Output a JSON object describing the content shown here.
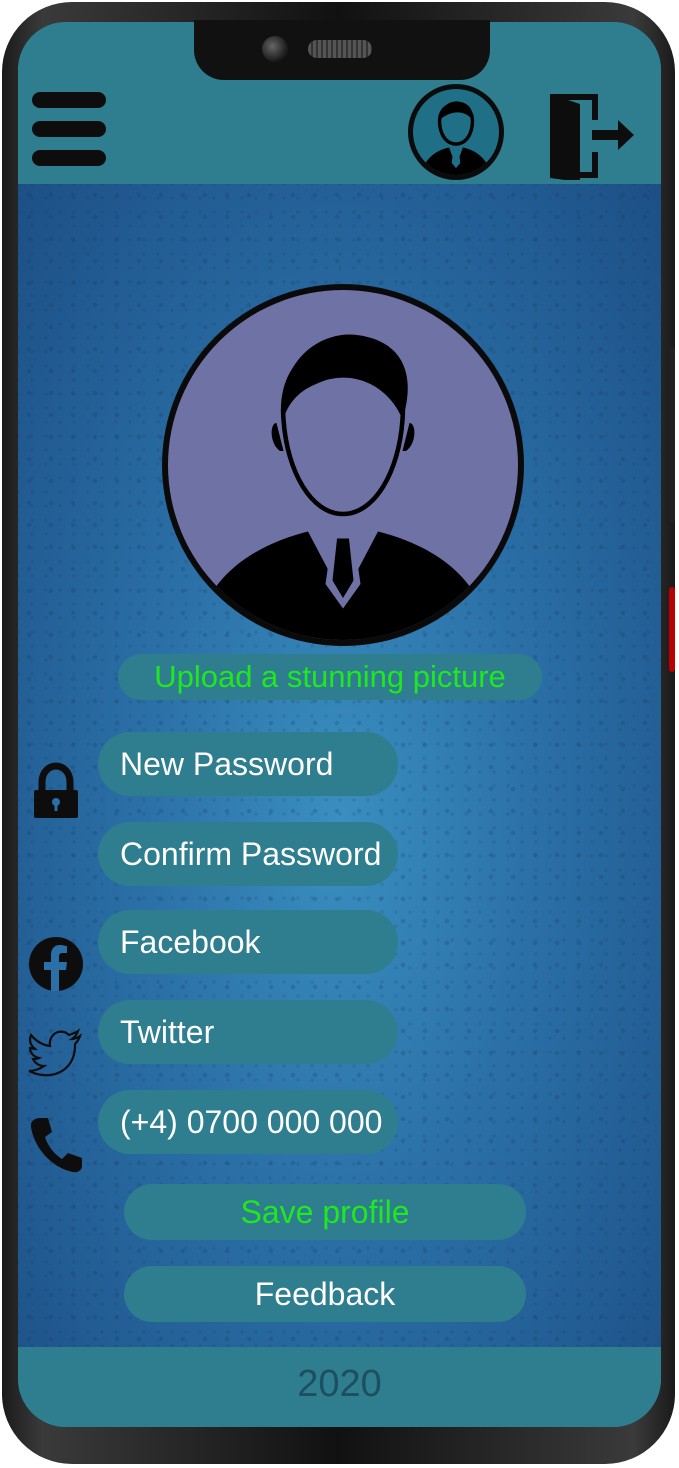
{
  "header": {
    "menu_icon": "hamburger-menu-icon",
    "avatar_icon": "user-avatar-icon",
    "logout_icon": "logout-door-icon"
  },
  "profile": {
    "picture_icon": "user-avatar-icon",
    "upload_label": "Upload a stunning picture"
  },
  "form": {
    "new_password": "New Password",
    "confirm_password": "Confirm Password",
    "facebook": "Facebook",
    "twitter": "Twitter",
    "phone": "(+4) 0700 000 000"
  },
  "icons": {
    "lock": "lock-icon",
    "facebook": "facebook-icon",
    "twitter": "twitter-icon",
    "phone": "phone-icon"
  },
  "actions": {
    "save_label": "Save profile",
    "feedback_label": "Feedback"
  },
  "footer": {
    "year": "2020"
  },
  "colors": {
    "bar": "#2e7e8f",
    "accent_green": "#1fe81f",
    "background_blue": "#2a6fa6"
  }
}
